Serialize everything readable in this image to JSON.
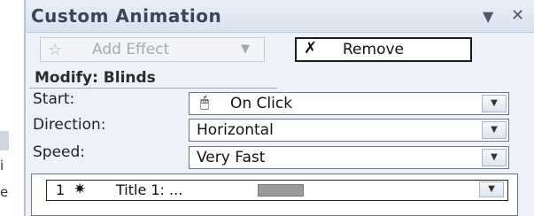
{
  "background_fragments": [
    "",
    "i",
    "e"
  ],
  "panel": {
    "title": "Custom Animation",
    "menu_icon": "dropdown-arrow-icon",
    "close_icon": "close-icon"
  },
  "toolbar": {
    "add_effect_label": "Add Effect",
    "add_effect_icon": "star-effect-icon",
    "remove_label": "Remove",
    "remove_icon": "remove-effect-icon"
  },
  "modify": {
    "heading": "Modify: Blinds"
  },
  "fields": [
    {
      "label": "Start:",
      "value": "On Click",
      "icon": "mouse-click-icon"
    },
    {
      "label": "Direction:",
      "value": "Horizontal"
    },
    {
      "label": "Speed:",
      "value": "Very Fast"
    }
  ],
  "effects_list": [
    {
      "number": "1",
      "icon": "entrance-effect-star-icon",
      "label": "Title 1: ..."
    }
  ],
  "colors": {
    "pane_bg": "#eef2f8",
    "timeline_bar": "#9a9a9a"
  }
}
